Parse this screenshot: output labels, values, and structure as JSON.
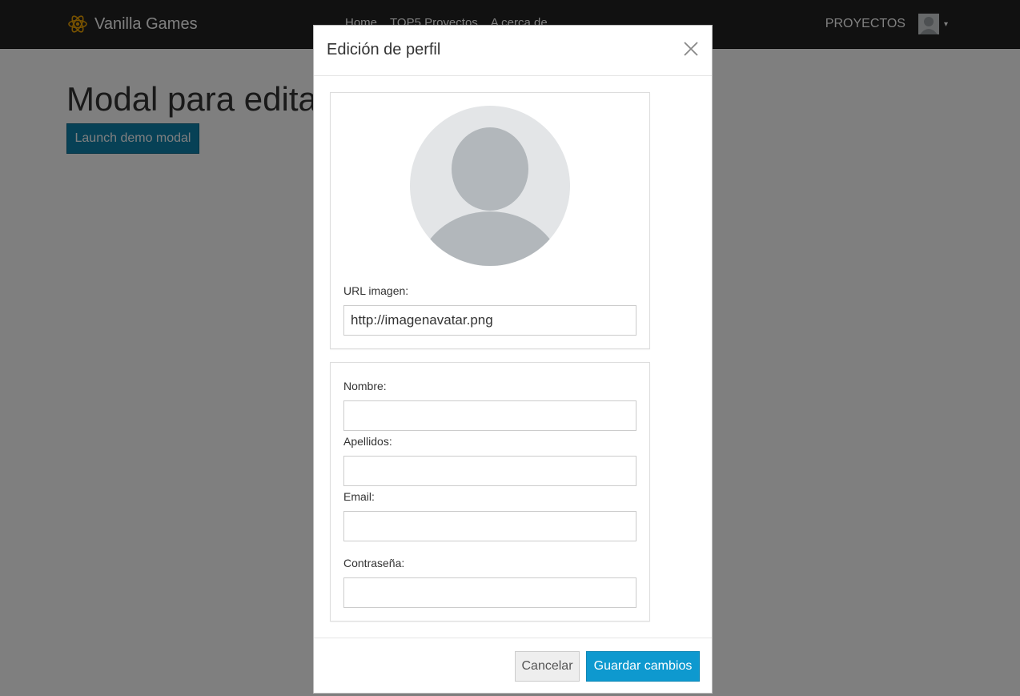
{
  "navbar": {
    "brand": "Vanilla Games",
    "brand_icon": "atom-icon",
    "links": [
      "Home",
      "TOP5 Proyectos",
      "A cerca de"
    ],
    "projects_label": "PROYECTOS"
  },
  "page": {
    "heading": "Modal para editar perfil",
    "launch_button": "Launch demo modal"
  },
  "modal": {
    "title": "Edición de perfil",
    "avatar_icon": "user-avatar-placeholder-icon",
    "url_label": "URL imagen:",
    "url_value": "http://imagenavatar.png",
    "fields": {
      "nombre_label": "Nombre:",
      "apellidos_label": "Apellidos:",
      "email_label": "Email:",
      "password_label": "Contraseña:"
    },
    "cancel": "Cancelar",
    "save": "Guardar cambios"
  },
  "colors": {
    "navbar_bg": "#222222",
    "primary": "#0e99cf",
    "backdrop": "rgba(0,0,0,0.5)"
  }
}
